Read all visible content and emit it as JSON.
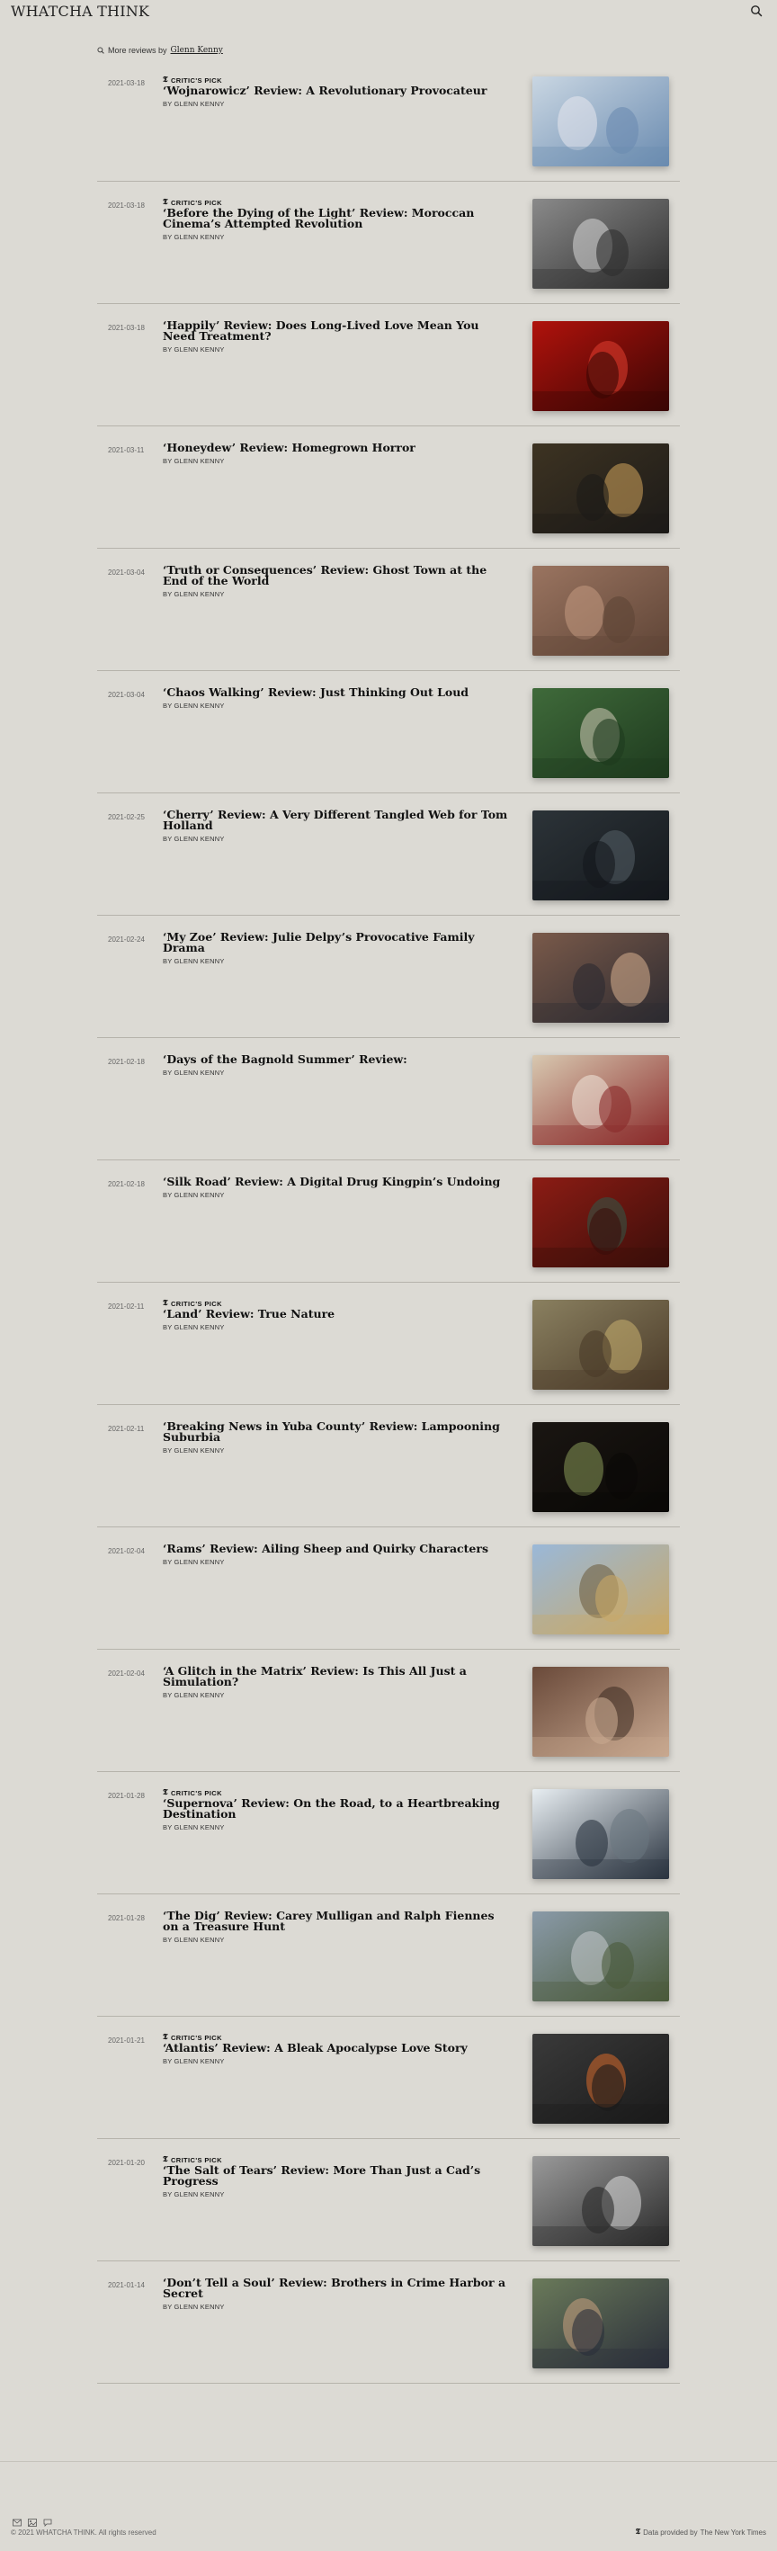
{
  "header": {
    "brand": "WHATCHA THINK",
    "search_icon": "search-icon"
  },
  "more_reviews": {
    "prefix": "More reviews by",
    "author": "Glenn Kenny"
  },
  "reviews": [
    {
      "date": "2021-03-18",
      "critics_pick": true,
      "title": "‘Wojnarowicz’ Review: A Revolutionary Provocateur",
      "byline": "BY GLENN KENNY",
      "image_colors": [
        "#c9d6e2",
        "#6a8bb0",
        "#e8e8ee"
      ]
    },
    {
      "date": "2021-03-18",
      "critics_pick": true,
      "title": "‘Before the Dying of the Light’ Review: Moroccan Cinema’s Attempted Revolution",
      "byline": "BY GLENN KENNY",
      "image_colors": [
        "#8a8a8a",
        "#2e2e2e",
        "#d8d8d8"
      ]
    },
    {
      "date": "2021-03-18",
      "critics_pick": false,
      "title": "‘Happily’ Review: Does Long-Lived Love Mean You Need Treatment?",
      "byline": "BY GLENN KENNY",
      "image_colors": [
        "#b0120c",
        "#3a0604",
        "#e24030"
      ]
    },
    {
      "date": "2021-03-11",
      "critics_pick": false,
      "title": "‘Honeydew’ Review: Homegrown Horror",
      "byline": "BY GLENN KENNY",
      "image_colors": [
        "#3d3322",
        "#1c1a18",
        "#d4a55c"
      ]
    },
    {
      "date": "2021-03-04",
      "critics_pick": false,
      "title": "‘Truth or Consequences’ Review: Ghost Town at the End of the World",
      "byline": "BY GLENN KENNY",
      "image_colors": [
        "#9a7460",
        "#5e4436",
        "#c49a82"
      ]
    },
    {
      "date": "2021-03-04",
      "critics_pick": false,
      "title": "‘Chaos Walking’ Review: Just Thinking Out Loud",
      "byline": "BY GLENN KENNY",
      "image_colors": [
        "#3f6a3a",
        "#1e3a1e",
        "#d2cbb8"
      ]
    },
    {
      "date": "2021-02-25",
      "critics_pick": false,
      "title": "‘Cherry’ Review: A Very Different Tangled Web for Tom Holland",
      "byline": "BY GLENN KENNY",
      "image_colors": [
        "#2c3338",
        "#14181c",
        "#566068"
      ]
    },
    {
      "date": "2021-02-24",
      "critics_pick": false,
      "title": "‘My Zoe’ Review: Julie Delpy’s Provocative Family Drama",
      "byline": "BY GLENN KENNY",
      "image_colors": [
        "#7a5a4a",
        "#2c2a30",
        "#d8b090"
      ]
    },
    {
      "date": "2021-02-18",
      "critics_pick": false,
      "title": "‘Days of the Bagnold Summer’ Review:",
      "byline": "BY GLENN KENNY",
      "image_colors": [
        "#d8c8b0",
        "#8a2a2a",
        "#f0e8dc"
      ]
    },
    {
      "date": "2021-02-18",
      "critics_pick": false,
      "title": "‘Silk Road’ Review: A Digital Drug Kingpin’s Undoing",
      "byline": "BY GLENN KENNY",
      "image_colors": [
        "#8c1c14",
        "#3a0e0a",
        "#2e5a48"
      ]
    },
    {
      "date": "2021-02-11",
      "critics_pick": true,
      "title": "‘Land’ Review: True Nature",
      "byline": "BY GLENN KENNY",
      "image_colors": [
        "#8a8060",
        "#4a3a28",
        "#c8b070"
      ]
    },
    {
      "date": "2021-02-11",
      "critics_pick": false,
      "title": "‘Breaking News in Yuba County’ Review: Lampooning Suburbia",
      "byline": "BY GLENN KENNY",
      "image_colors": [
        "#1a1612",
        "#0a0806",
        "#8a9a5a"
      ]
    },
    {
      "date": "2021-02-04",
      "critics_pick": false,
      "title": "‘Rams’ Review: Ailing Sheep and Quirky Characters",
      "byline": "BY GLENN KENNY",
      "image_colors": [
        "#9ab8d8",
        "#c8a868",
        "#6a5a3a"
      ]
    },
    {
      "date": "2021-02-04",
      "critics_pick": false,
      "title": "‘A Glitch in the Matrix’ Review: Is This All Just a Simulation?",
      "byline": "BY GLENN KENNY",
      "image_colors": [
        "#6a4a3a",
        "#c8a890",
        "#3a2a20"
      ]
    },
    {
      "date": "2021-01-28",
      "critics_pick": true,
      "title": "‘Supernova’ Review: On the Road, to a Heartbreaking Destination",
      "byline": "BY GLENN KENNY",
      "image_colors": [
        "#e8eef2",
        "#2a3440",
        "#6a7680"
      ]
    },
    {
      "date": "2021-01-28",
      "critics_pick": false,
      "title": "‘The Dig’ Review: Carey Mulligan and Ralph Fiennes on a Treasure Hunt",
      "byline": "BY GLENN KENNY",
      "image_colors": [
        "#8a9aa8",
        "#4a5a3a",
        "#c8ccd0"
      ]
    },
    {
      "date": "2021-01-21",
      "critics_pick": true,
      "title": "‘Atlantis’ Review: A Bleak Apocalypse Love Story",
      "byline": "BY GLENN KENNY",
      "image_colors": [
        "#3a3a3a",
        "#1a1a1a",
        "#d86a2a"
      ]
    },
    {
      "date": "2021-01-20",
      "critics_pick": true,
      "title": "‘The Salt of Tears’ Review: More Than Just a Cad’s Progress",
      "byline": "BY GLENN KENNY",
      "image_colors": [
        "#9a9a9a",
        "#2a2a2a",
        "#e0e0e0"
      ]
    },
    {
      "date": "2021-01-14",
      "critics_pick": false,
      "title": "‘Don’t Tell a Soul’ Review: Brothers in Crime Harbor a Secret",
      "byline": "BY GLENN KENNY",
      "image_colors": [
        "#6a7a5a",
        "#2a2e3a",
        "#c8a080"
      ]
    }
  ],
  "critics_pick_label": "CRITIC'S PICK",
  "footer": {
    "icons": [
      "mail-icon",
      "image-icon",
      "chat-icon"
    ],
    "copyright": "© 2021 WHATCHA THINK. All rights reserved",
    "provided_prefix": "Data provided by",
    "provided_by": "The New York Times"
  }
}
